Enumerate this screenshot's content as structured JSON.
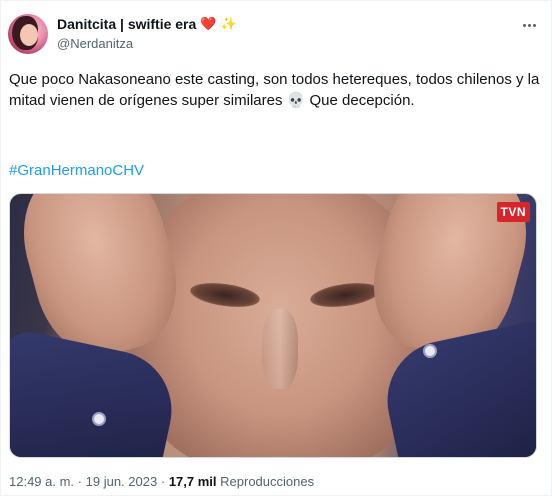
{
  "author": {
    "display_name": "Danitcita | swiftie era",
    "name_emojis": [
      "❤️",
      "✨"
    ],
    "handle": "@Nerdanitza",
    "avatar_icon": "profile-avatar"
  },
  "tweet": {
    "text": "Que poco Nakasoneano este casting, son todos hetereques, todos chilenos y la mitad vienen de orígenes super similares",
    "text_emoji": "💀",
    "text_after_emoji": "Que decepción.",
    "hashtag": "#GranHermanoCHV"
  },
  "media": {
    "watermark": "TVN"
  },
  "meta": {
    "time": "12:49 a. m.",
    "separator": "·",
    "date": "19 jun. 2023",
    "views_count": "17,7 mil",
    "views_label": "Reproducciones"
  },
  "colors": {
    "link": "#1d9bf0",
    "secondary_text": "#536471",
    "primary_text": "#0f1419",
    "watermark_bg": "#d7262a"
  }
}
